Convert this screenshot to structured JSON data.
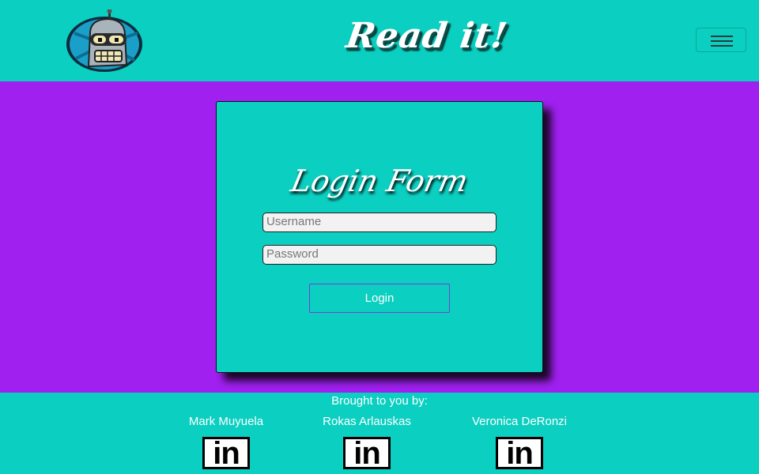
{
  "header": {
    "brand": "Read it!",
    "logo_icon": "robot-head-logo-icon",
    "menu_icon": "hamburger-icon"
  },
  "login": {
    "title": "Login Form",
    "username_placeholder": "Username",
    "password_placeholder": "Password",
    "username_value": "",
    "password_value": "",
    "submit_label": "Login"
  },
  "footer": {
    "credit_label": "Brought to you by:",
    "members": [
      {
        "name": "Mark Muyuela",
        "icon": "linkedin-icon",
        "icon_text": "in"
      },
      {
        "name": "Rokas Arlauskas",
        "icon": "linkedin-icon",
        "icon_text": "in"
      },
      {
        "name": "Veronica DeRonzi",
        "icon": "linkedin-icon",
        "icon_text": "in"
      }
    ]
  },
  "colors": {
    "teal": "#0bcfc0",
    "purple": "#a020f0",
    "button_border": "#7a3bd8"
  }
}
